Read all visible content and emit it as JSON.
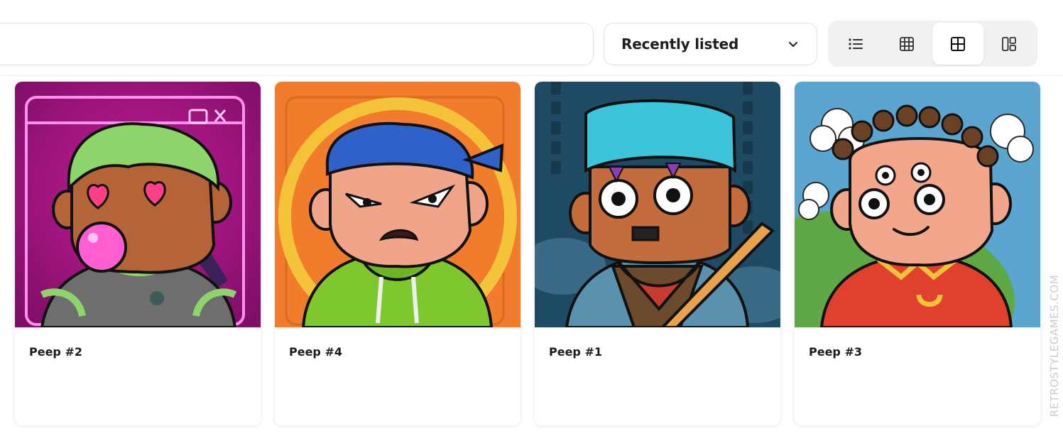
{
  "search": {
    "value": "",
    "placeholder": ""
  },
  "sort": {
    "selected": "Recently listed",
    "icon": "chevron-down-icon"
  },
  "view_toggle": {
    "buttons": [
      {
        "icon": "list-view-icon",
        "active": false
      },
      {
        "icon": "small-grid-icon",
        "active": false
      },
      {
        "icon": "large-grid-icon",
        "active": true
      },
      {
        "icon": "masonry-grid-icon",
        "active": false
      }
    ]
  },
  "cards": [
    {
      "name": "Peep #2",
      "bg": "#a0157f"
    },
    {
      "name": "Peep #4",
      "bg": "#f07c2c"
    },
    {
      "name": "Peep #1",
      "bg": "#1f4a63"
    },
    {
      "name": "Peep #3",
      "bg": "#5aa6d1"
    }
  ],
  "watermark": "RETROSTYLEGAMES.COM"
}
